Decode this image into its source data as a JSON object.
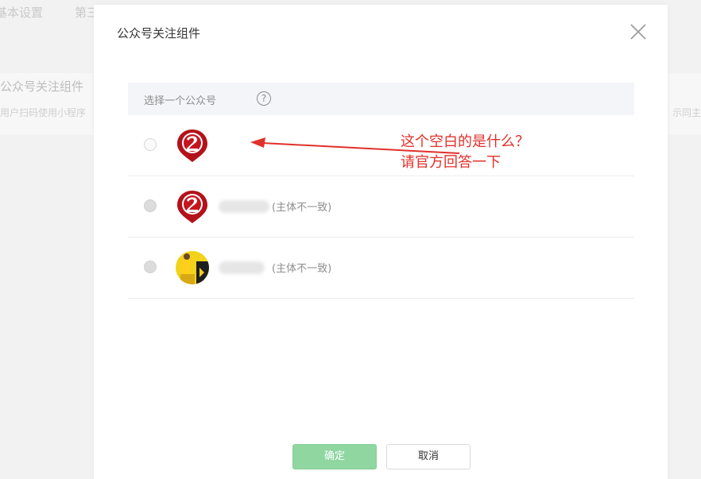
{
  "background": {
    "tab_basic": "基本设置",
    "tab_third": "第三",
    "section_title": "公众号关注组件",
    "section_desc": "用户扫码使用小程序",
    "section_desc_right": "示同主"
  },
  "modal": {
    "title": "公众号关注组件",
    "select_label": "选择一个公众号",
    "help_icon_text": "?",
    "accounts": [
      {
        "avatar": "red-badge-logo",
        "name": "",
        "note": ""
      },
      {
        "avatar": "red-badge-logo",
        "name": "",
        "note": "(主体不一致)"
      },
      {
        "avatar": "yellow-photo",
        "name": "",
        "note": "(主体不一致)"
      }
    ],
    "confirm_label": "确定",
    "cancel_label": "取消"
  },
  "annotation": {
    "line1": "这个空白的是什么？",
    "line2": "请官方回答一下",
    "color": "#e0312b"
  },
  "colors": {
    "confirm_bg": "#8fd6a0",
    "header_bg": "#f4f5f9",
    "logo_red": "#b3121b"
  },
  "icons": {
    "close": "close-icon",
    "help": "help-icon",
    "arrow": "arrow-left-icon"
  }
}
